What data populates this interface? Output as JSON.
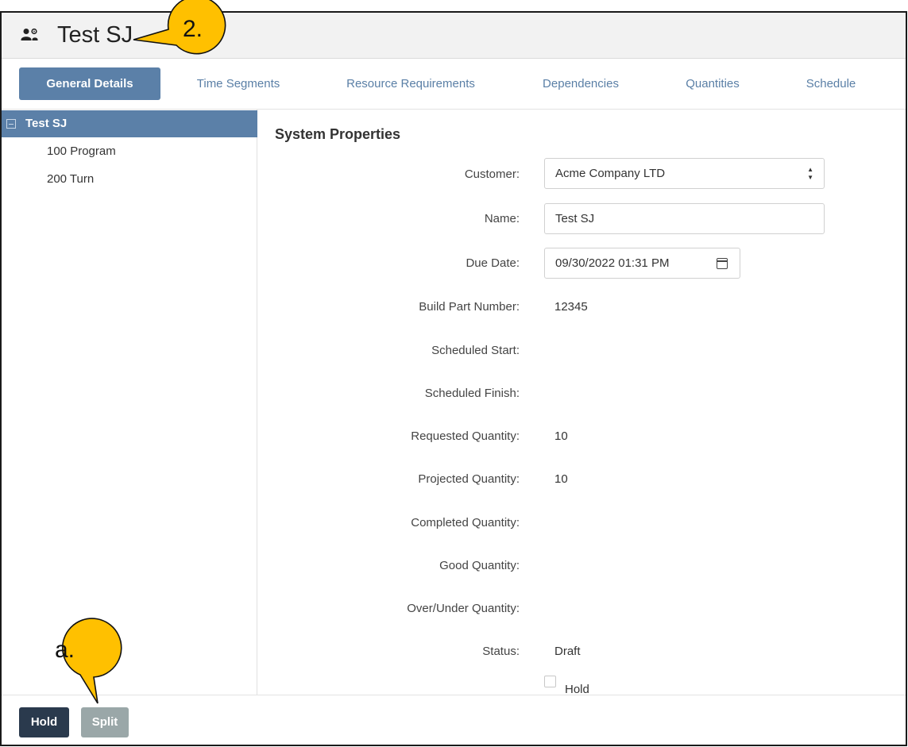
{
  "header": {
    "title": "Test SJ",
    "icon": "user-group-gear-icon"
  },
  "tabs": [
    {
      "label": "General Details",
      "active": true
    },
    {
      "label": "Time Segments",
      "active": false
    },
    {
      "label": "Resource Requirements",
      "active": false
    },
    {
      "label": "Dependencies",
      "active": false
    },
    {
      "label": "Quantities",
      "active": false
    },
    {
      "label": "Schedule",
      "active": false
    }
  ],
  "tree": {
    "root": {
      "label": "Test SJ",
      "expanded": true
    },
    "children": [
      {
        "label": "100 Program"
      },
      {
        "label": "200 Turn"
      }
    ]
  },
  "system_properties": {
    "title": "System Properties",
    "customer": {
      "label": "Customer:",
      "value": "Acme Company LTD"
    },
    "name": {
      "label": "Name:",
      "value": "Test SJ"
    },
    "due_date": {
      "label": "Due Date:",
      "value": "09/30/2022 01:31 PM"
    },
    "build_part_number": {
      "label": "Build Part Number:",
      "value": "12345"
    },
    "scheduled_start": {
      "label": "Scheduled Start:",
      "value": ""
    },
    "scheduled_finish": {
      "label": "Scheduled Finish:",
      "value": ""
    },
    "requested_quantity": {
      "label": "Requested Quantity:",
      "value": "10"
    },
    "projected_quantity": {
      "label": "Projected Quantity:",
      "value": "10"
    },
    "completed_quantity": {
      "label": "Completed Quantity:",
      "value": ""
    },
    "good_quantity": {
      "label": "Good Quantity:",
      "value": ""
    },
    "over_under_quantity": {
      "label": "Over/Under Quantity:",
      "value": ""
    },
    "status": {
      "label": "Status:",
      "value": "Draft"
    },
    "hold_checkbox": {
      "label": "Hold",
      "checked": false
    }
  },
  "footer": {
    "hold_button": "Hold",
    "split_button": "Split"
  },
  "callouts": {
    "top": "2.",
    "bottom": "a.",
    "color": "#ffc000"
  },
  "colors": {
    "accent": "#5b80a8",
    "hold_button": "#2a3a4d",
    "split_button": "#9aa7a8",
    "tab_text": "#5a7fa6"
  }
}
